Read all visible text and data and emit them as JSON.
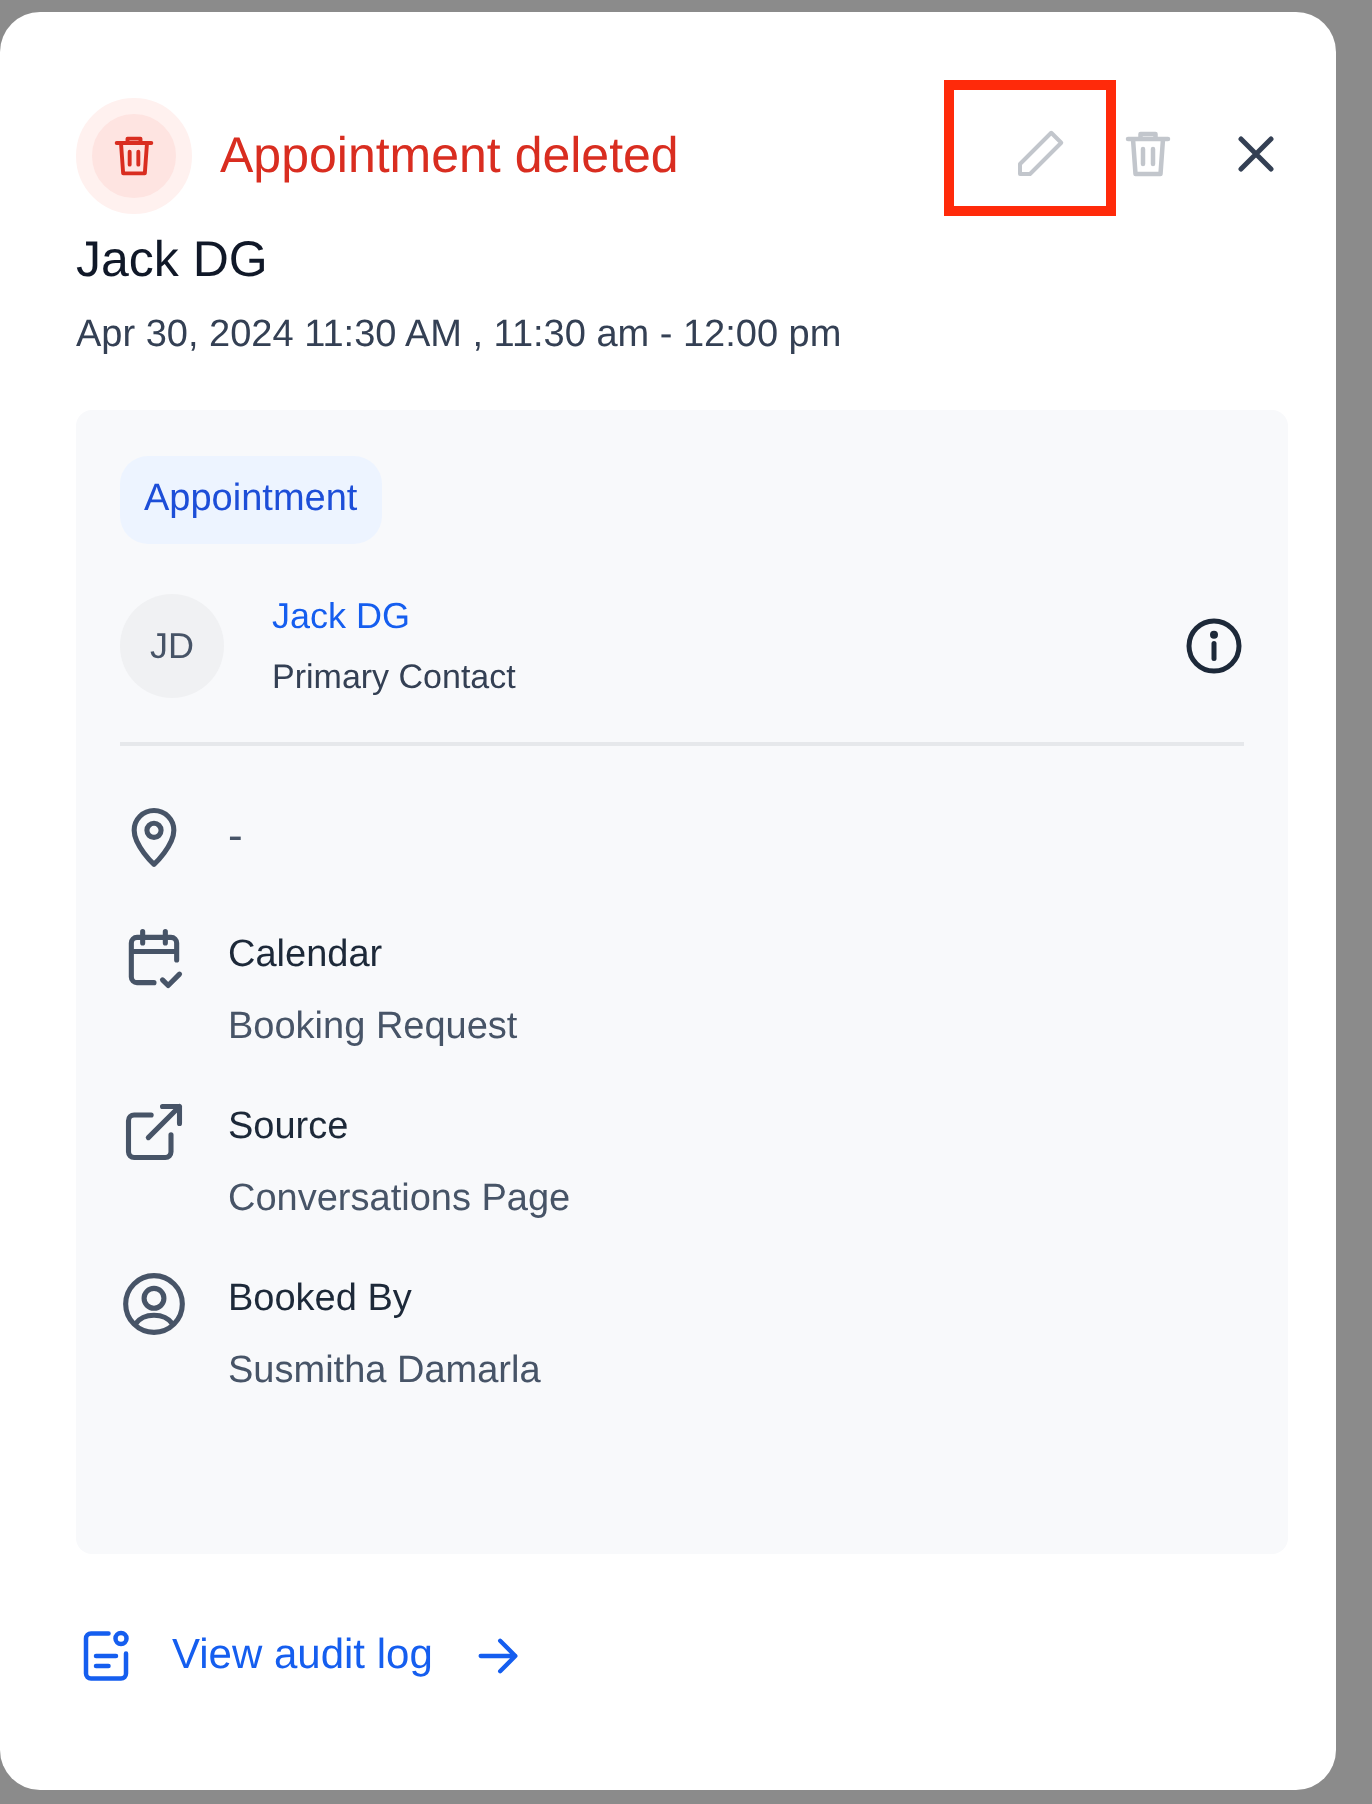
{
  "modal": {
    "status": {
      "kind": "deleted",
      "title": "Appointment deleted"
    },
    "actions": [
      {
        "kind": "edit",
        "disabled": true,
        "highlighted": true
      },
      {
        "kind": "delete",
        "disabled": true,
        "highlighted": false
      },
      {
        "kind": "close",
        "disabled": false,
        "highlighted": false
      }
    ],
    "contact_name": "Jack DG",
    "datetime": "Apr 30, 2024 11:30 AM , 11:30 am - 12:00 pm",
    "card": {
      "tag": "Appointment",
      "contact": {
        "initials": "JD",
        "name": "Jack DG",
        "role": "Primary Contact"
      },
      "details": [
        {
          "kind": "location",
          "value": "-"
        },
        {
          "kind": "calendar",
          "label": "Calendar",
          "value": "Booking Request"
        },
        {
          "kind": "source",
          "label": "Source",
          "value": "Conversations Page"
        },
        {
          "kind": "user",
          "label": "Booked By",
          "value": "Susmitha Damarla"
        }
      ]
    },
    "footer_link": "View audit log"
  }
}
